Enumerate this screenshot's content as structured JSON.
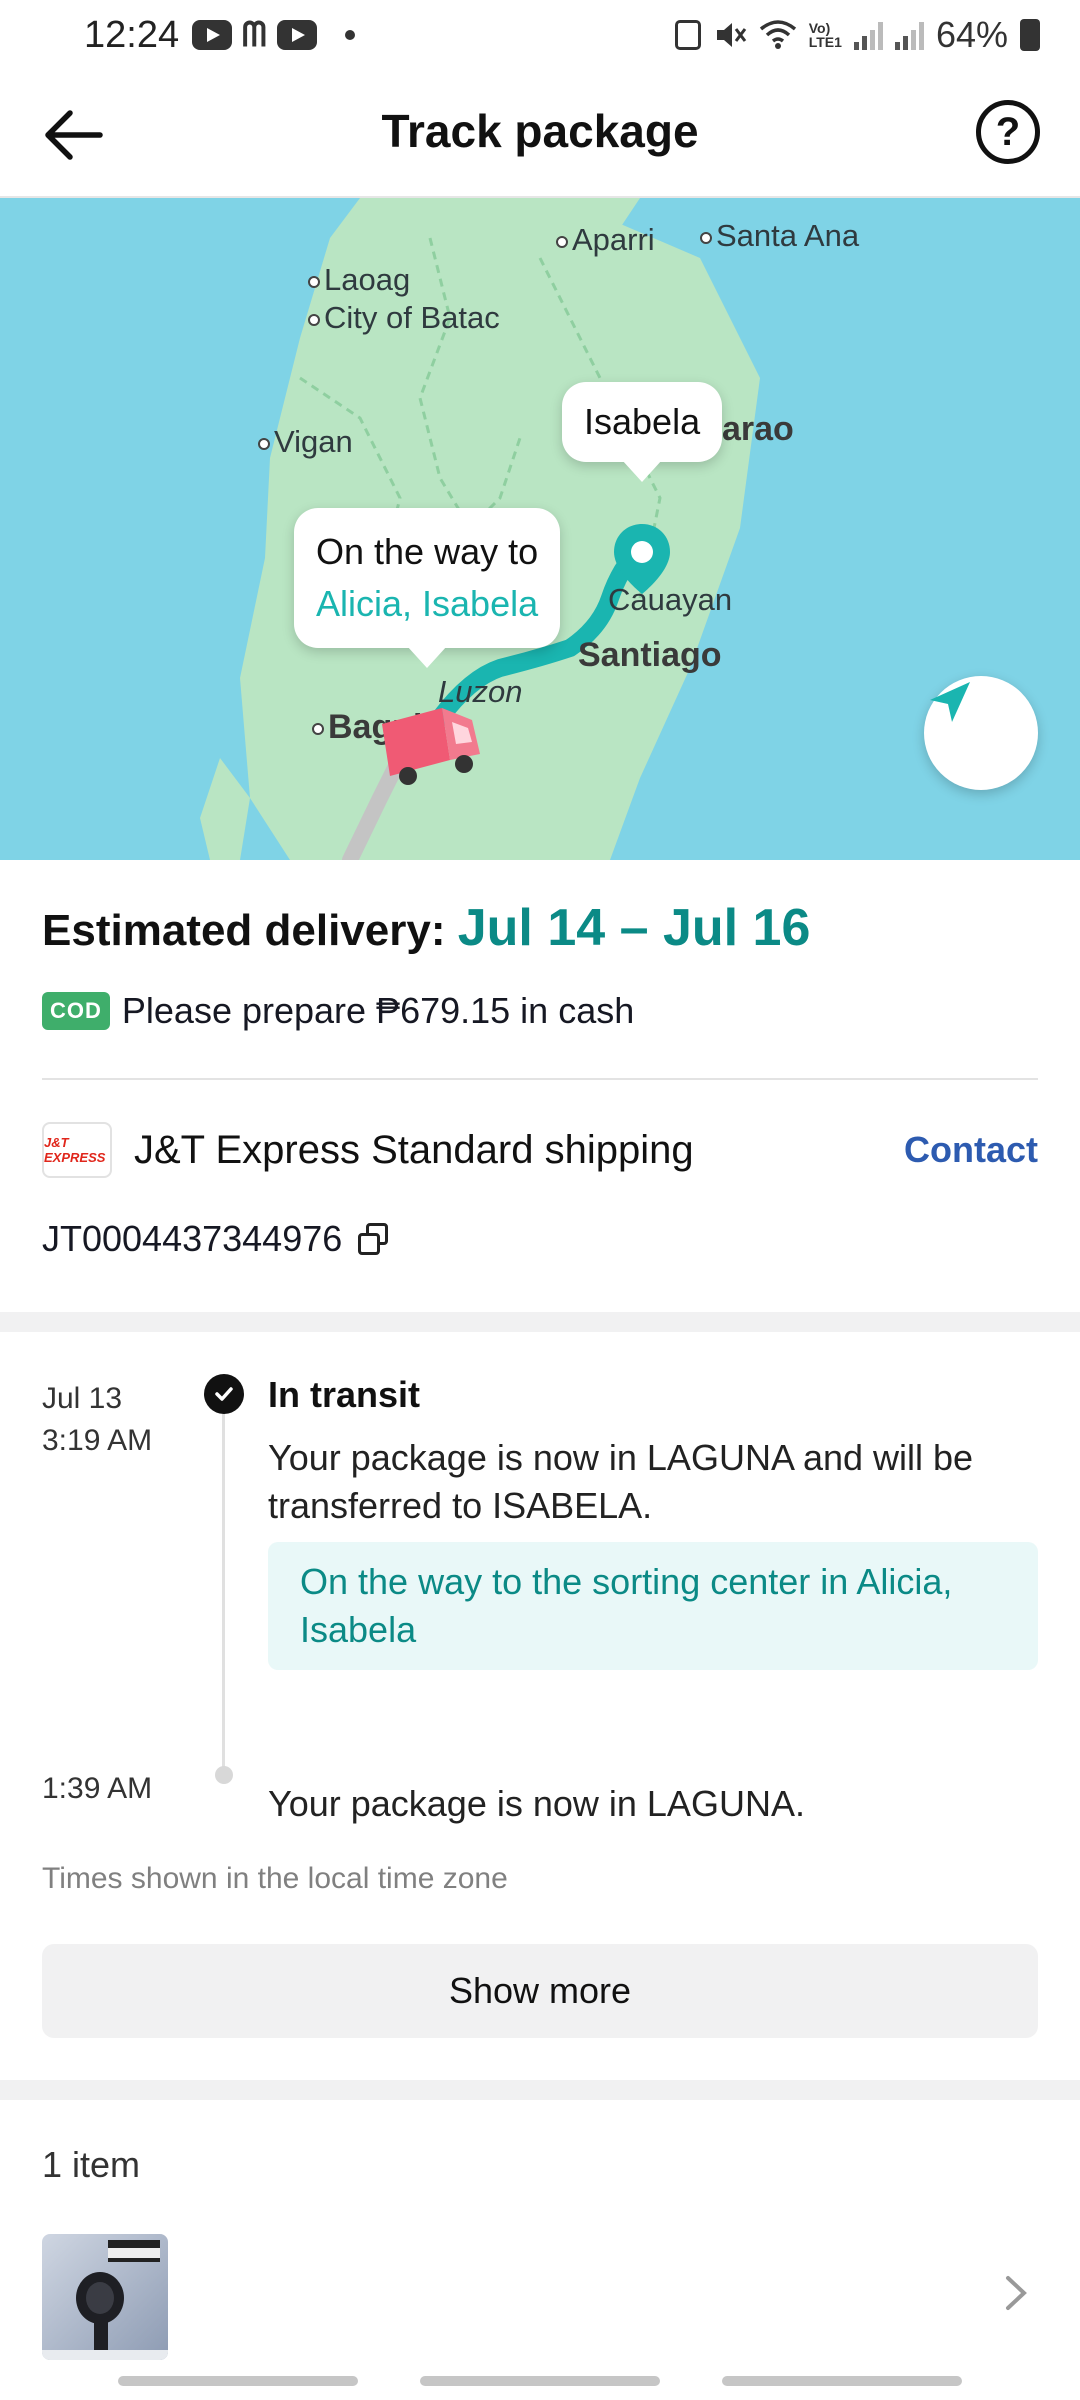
{
  "status_bar": {
    "time": "12:24",
    "battery": "64%",
    "icons": [
      "youtube-icon",
      "mcdonalds-icon",
      "youtube-icon",
      "dot",
      "battery-saver-icon",
      "mute-icon",
      "wifi-icon",
      "volte-icon",
      "signal-icon",
      "signal-icon",
      "battery-icon"
    ]
  },
  "header": {
    "title": "Track package",
    "back_icon": "back-arrow-icon",
    "help_icon": "help-icon"
  },
  "map": {
    "labels": [
      "Aparri",
      "Santa Ana",
      "Laoag",
      "City of Batac",
      "Vigan",
      "Cauayan",
      "Santiago",
      "Luzon",
      "Bagui",
      "arao"
    ],
    "destination_bubble": "Isabela",
    "route_bubble_line1": "On the way to",
    "route_bubble_line2": "Alicia, Isabela",
    "colors": {
      "water": "#7fd3e6",
      "land": "#b9e5c3",
      "route": "#1ab5b0",
      "truck": "#f05a74"
    }
  },
  "delivery": {
    "estimated_label": "Estimated delivery:",
    "estimated_range": "Jul 14 – Jul 16",
    "cod_badge": "COD",
    "cod_text": "Please prepare ₱679.15 in cash"
  },
  "carrier": {
    "logo_text": "J&T EXPRESS",
    "name": "J&T Express Standard shipping",
    "contact_label": "Contact",
    "tracking_number": "JT0004437344976"
  },
  "timeline": {
    "events": [
      {
        "date": "Jul 13",
        "time": "3:19 AM",
        "status": "In transit",
        "description": "Your package is now in LAGUNA and will be transferred to ISABELA.",
        "note": "On the way to the sorting center in Alicia, Isabela"
      },
      {
        "time": "1:39 AM",
        "description": "Your package is now in LAGUNA."
      }
    ],
    "timezone_note": "Times shown in the local time zone",
    "show_more_label": "Show more"
  },
  "items": {
    "title": "1 item"
  }
}
